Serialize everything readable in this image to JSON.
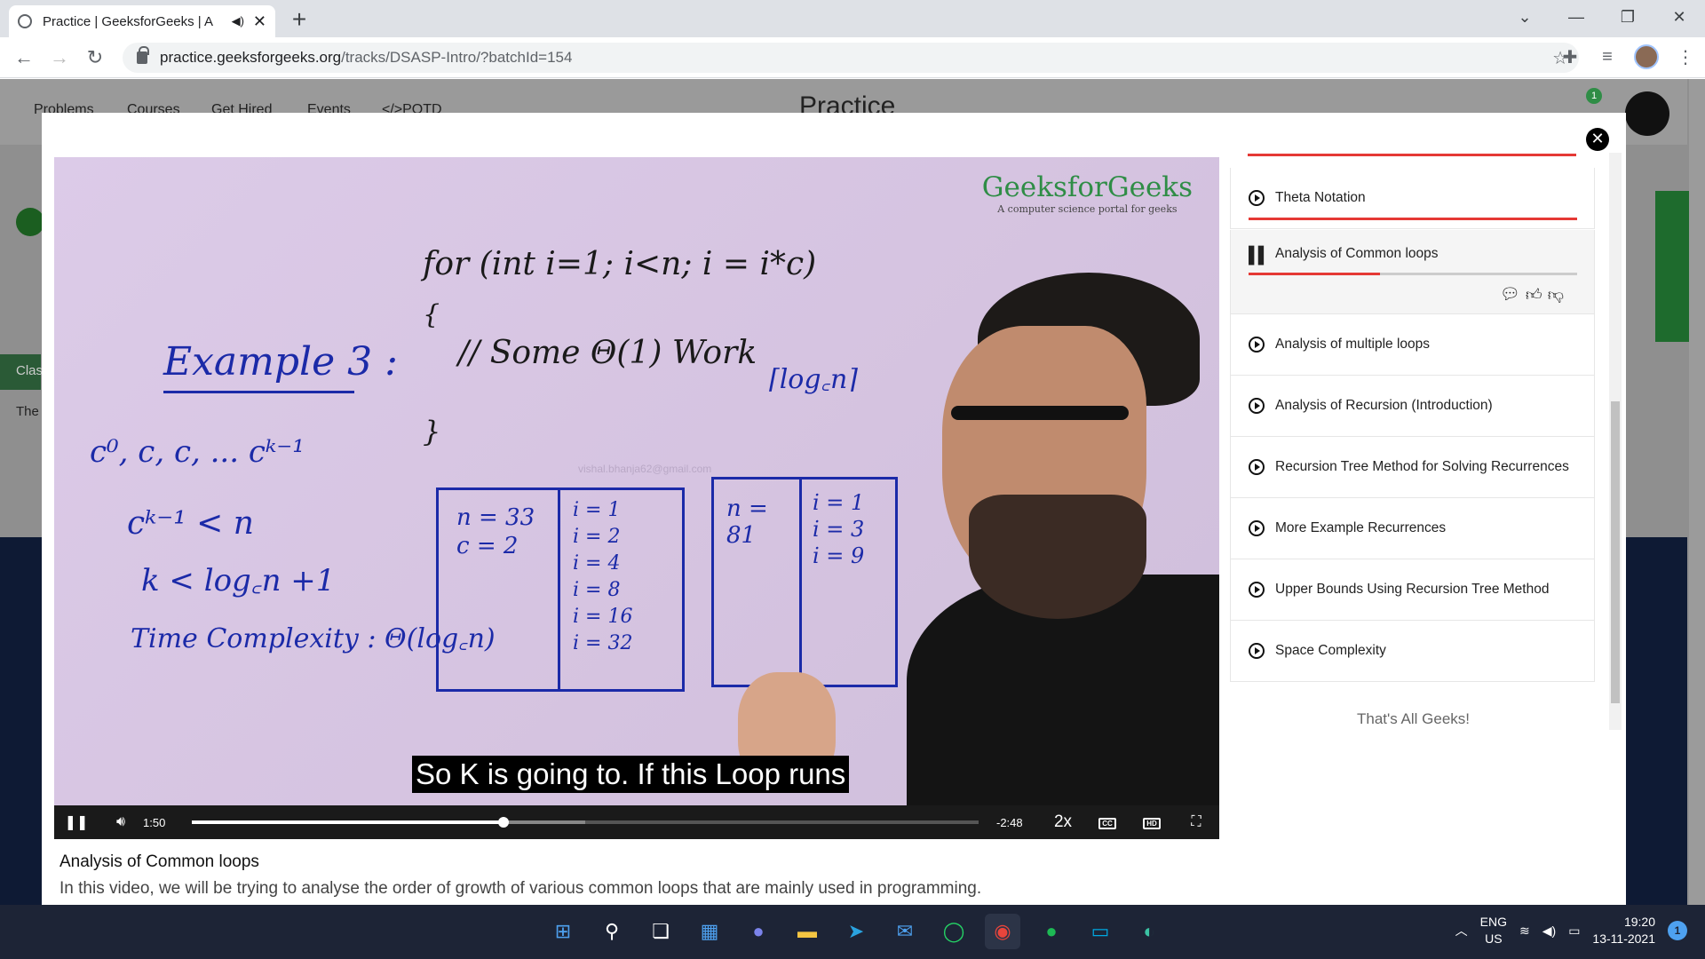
{
  "browser": {
    "tab_title": "Practice | GeeksforGeeks | A",
    "url_domain": "practice.geeksforgeeks.org",
    "url_path": "/tracks/DSASP-Intro/?batchId=154"
  },
  "page_behind": {
    "nav": [
      "Problems",
      "Courses",
      "Get Hired",
      "Events",
      "</>POTD"
    ],
    "logo_text": "Practice",
    "notification_count": "1",
    "side_labels": [
      "Clas",
      "The"
    ]
  },
  "video": {
    "brand": "GeeksforGeeks",
    "brand_tagline": "A computer science portal for geeks",
    "watermark_email": "vishal.bhanja62@gmail.com",
    "board": {
      "example_title": "Example 3 :",
      "loop_line": "for (int i=1; i<n; i = i*c)",
      "open_brace": "{",
      "comment": "// Some Θ(1) Work",
      "close_brace": "}",
      "ceil_log": "⌈log꜀n⌉",
      "series": "c⁰, c, c, ... cᵏ⁻¹",
      "ineq1": "cᵏ⁻¹ < n",
      "ineq2": "k < log꜀n +1",
      "complexity": "Time Complexity : Θ(log꜀n)",
      "box1_left": [
        "n = 33",
        "c = 2"
      ],
      "box1_right": [
        "i = 1",
        "i = 2",
        "i = 4",
        "i = 8",
        "i = 16",
        "i = 32"
      ],
      "box2_left": [
        "n = 81"
      ],
      "box2_right": [
        "i = 1",
        "i = 3",
        "i = 9"
      ]
    },
    "caption": "So K is going to. If this Loop runs",
    "current_time": "1:50",
    "remaining_time": "-2:48",
    "speed": "2x",
    "progress_fraction": 0.396,
    "buffered_fraction": 0.5
  },
  "video_info": {
    "title": "Analysis of Common loops",
    "description": "In this video, we will be trying to analyse the order of growth of various common loops that are mainly used in programming."
  },
  "playlist": {
    "items": [
      {
        "label": "Theta Notation",
        "state": "watched"
      },
      {
        "label": "Analysis of Common loops",
        "state": "playing"
      },
      {
        "label": "Analysis of multiple loops",
        "state": "idle"
      },
      {
        "label": "Analysis of Recursion (Introduction)",
        "state": "idle"
      },
      {
        "label": "Recursion Tree Method for Solving Recurrences",
        "state": "idle"
      },
      {
        "label": "More Example Recurrences",
        "state": "idle"
      },
      {
        "label": "Upper Bounds Using Recursion Tree Method",
        "state": "idle"
      },
      {
        "label": "Space Complexity",
        "state": "idle"
      }
    ],
    "footer": "That's All Geeks!",
    "playing_progress_fraction": 0.4
  },
  "taskbar": {
    "lang_top": "ENG",
    "lang_bottom": "US",
    "time": "19:20",
    "date": "13-11-2021",
    "notification_count": "1"
  },
  "colors": {
    "gfg_green": "#2f8d46",
    "accent_red": "#e53935",
    "taskbar_bg": "#1d2436"
  }
}
